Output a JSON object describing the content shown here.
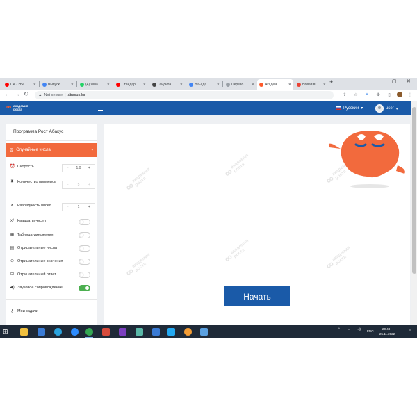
{
  "browser": {
    "tabs": [
      {
        "label": "ОА - НЯ",
        "color": "#ff0000"
      },
      {
        "label": "Выпуск",
        "color": "#4285f4"
      },
      {
        "label": "(4) Wha",
        "color": "#25d366"
      },
      {
        "label": "Стандар",
        "color": "#ff0000"
      },
      {
        "label": "Гайднон",
        "color": "#444444"
      },
      {
        "label": "ma-ада",
        "color": "#4285f4"
      },
      {
        "label": "Перево",
        "color": "#9aa0a6"
      },
      {
        "label": "Академ",
        "color": "#ff5a2b"
      },
      {
        "label": "Новая в",
        "color": "#ea4335"
      }
    ],
    "new_tab": "+",
    "win_min": "—",
    "win_max": "▢",
    "win_close": "✕",
    "back": "←",
    "forward": "→",
    "reload": "↻",
    "home": "⌂",
    "security_label": "Not secure",
    "url": "abacus.ka"
  },
  "site": {
    "logo_line1": "академия",
    "logo_line2": "роста",
    "language": "Русский",
    "user": "user"
  },
  "sidebar": {
    "title": "Программа Рост Абакус",
    "mode": "Случайные числа",
    "rows": [
      {
        "label": "Скорость",
        "value": "1.0"
      },
      {
        "label": "Количество примеров",
        "value": "5"
      },
      {
        "label": "Разрядность чисел",
        "value": "1"
      },
      {
        "label": "Квадраты чисел"
      },
      {
        "label": "Таблица умножения"
      },
      {
        "label": "Отрицательные числа"
      },
      {
        "label": "Отрицательные значения"
      },
      {
        "label": "Отрицательный ответ"
      },
      {
        "label": "Звуковое сопровождение"
      },
      {
        "label": "Мои задачи"
      }
    ]
  },
  "main": {
    "start_label": "Начать"
  },
  "taskbar": {
    "time": "20:48",
    "date": "25.11.2022",
    "lang": "ENG"
  }
}
